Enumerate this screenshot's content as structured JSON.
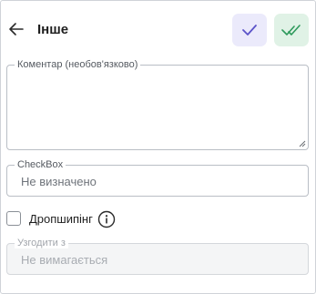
{
  "header": {
    "title": "Інше"
  },
  "comment": {
    "label": "Коментар (необов'язково)",
    "value": "",
    "placeholder": ""
  },
  "checkbox_field": {
    "label": "CheckBox",
    "value": "Не визначено"
  },
  "dropshipping": {
    "label": "Дропшипінг",
    "checked": false
  },
  "approve": {
    "label": "Узгодити з",
    "value": "Не вимагається"
  },
  "colors": {
    "check_button_bg": "#ebeafb",
    "check_icon": "#5b53c9",
    "double_check_button_bg": "#e0f2e6",
    "double_check_icon": "#2e9a5c"
  }
}
